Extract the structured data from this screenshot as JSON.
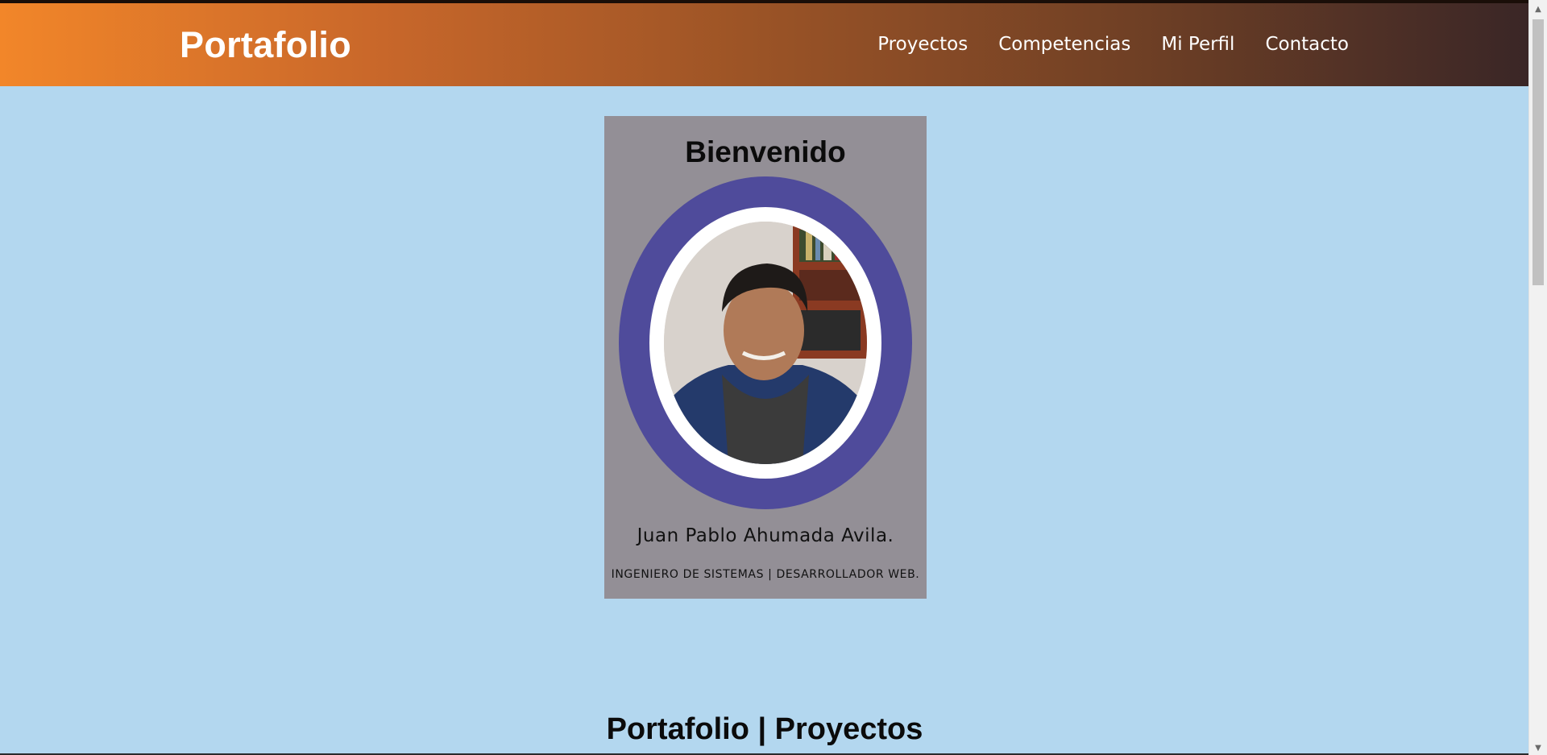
{
  "header": {
    "brand": "Portafolio",
    "nav": [
      "Proyectos",
      "Competencias",
      "Mi Perfil",
      "Contacto"
    ]
  },
  "card": {
    "title": "Bienvenido",
    "name": "Juan Pablo Ahumada Avila.",
    "role": "INGENIERO DE SISTEMAS | DESARROLLADOR WEB.",
    "photo_icon": "profile-photo"
  },
  "section": {
    "title": "Portafolio | Proyectos"
  },
  "colors": {
    "background": "#b3d7ef",
    "header_start": "#f28629",
    "header_end": "#3a2626",
    "card_bg": "#938f96",
    "ring": "#4f4b9b"
  }
}
